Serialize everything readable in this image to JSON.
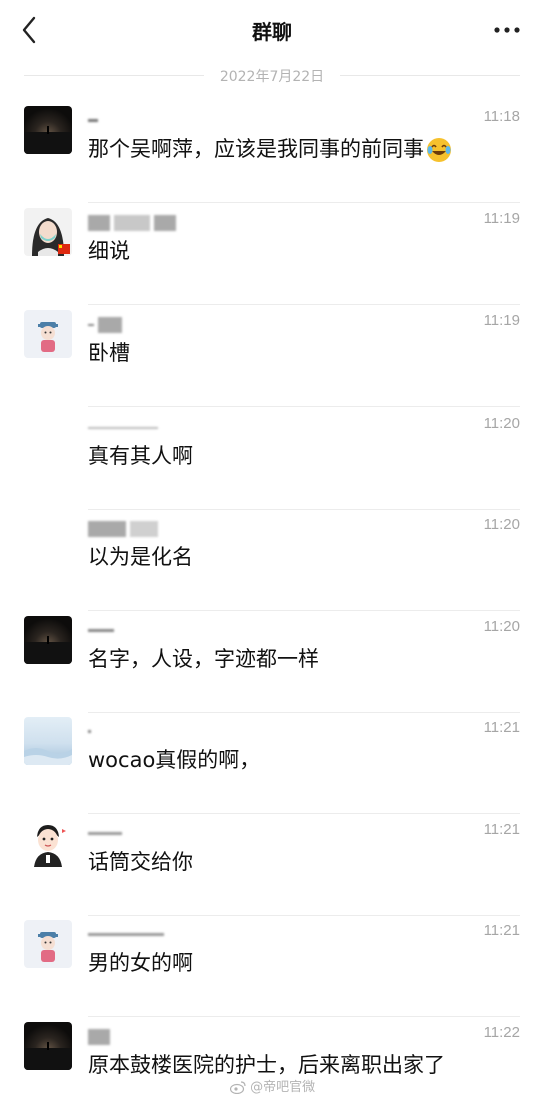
{
  "header": {
    "title": "群聊",
    "back_icon": "chevron-left-icon",
    "more_icon": "more-dots-icon"
  },
  "date_divider": "2022年7月22日",
  "messages": [
    {
      "sender": "",
      "time": "11:18",
      "text": "那个吴啊萍，应该是我同事的前同事",
      "avatar": "dark-night-avatar",
      "emoji": "laughing-tears-emoji"
    },
    {
      "sender": "",
      "time": "11:19",
      "text": "细说",
      "avatar": "girl-mask-avatar"
    },
    {
      "sender": "",
      "time": "11:19",
      "text": "卧槽",
      "avatar": "chibi-figure-avatar"
    },
    {
      "sender": "",
      "time": "11:20",
      "text": "真有其人啊",
      "avatar": ""
    },
    {
      "sender": "",
      "time": "11:20",
      "text": "以为是化名",
      "avatar": ""
    },
    {
      "sender": "",
      "time": "11:20",
      "text": "名字，人设，字迹都一样",
      "avatar": "dark-night-avatar"
    },
    {
      "sender": "",
      "time": "11:21",
      "text": "wocao真假的啊，",
      "avatar": "sea-sky-avatar"
    },
    {
      "sender": "",
      "time": "11:21",
      "text": "话筒交给你",
      "avatar": "cartoon-boy-avatar"
    },
    {
      "sender": "",
      "time": "11:21",
      "text": "男的女的啊",
      "avatar": "chibi-figure-avatar"
    },
    {
      "sender": "",
      "time": "11:22",
      "text": "原本鼓楼医院的护士，后来离职出家了",
      "avatar": "dark-night-avatar"
    }
  ],
  "watermark": "@帝吧官微",
  "colors": {
    "background": "#ffffff",
    "time": "#a6a6a6",
    "separator": "#ececec"
  }
}
